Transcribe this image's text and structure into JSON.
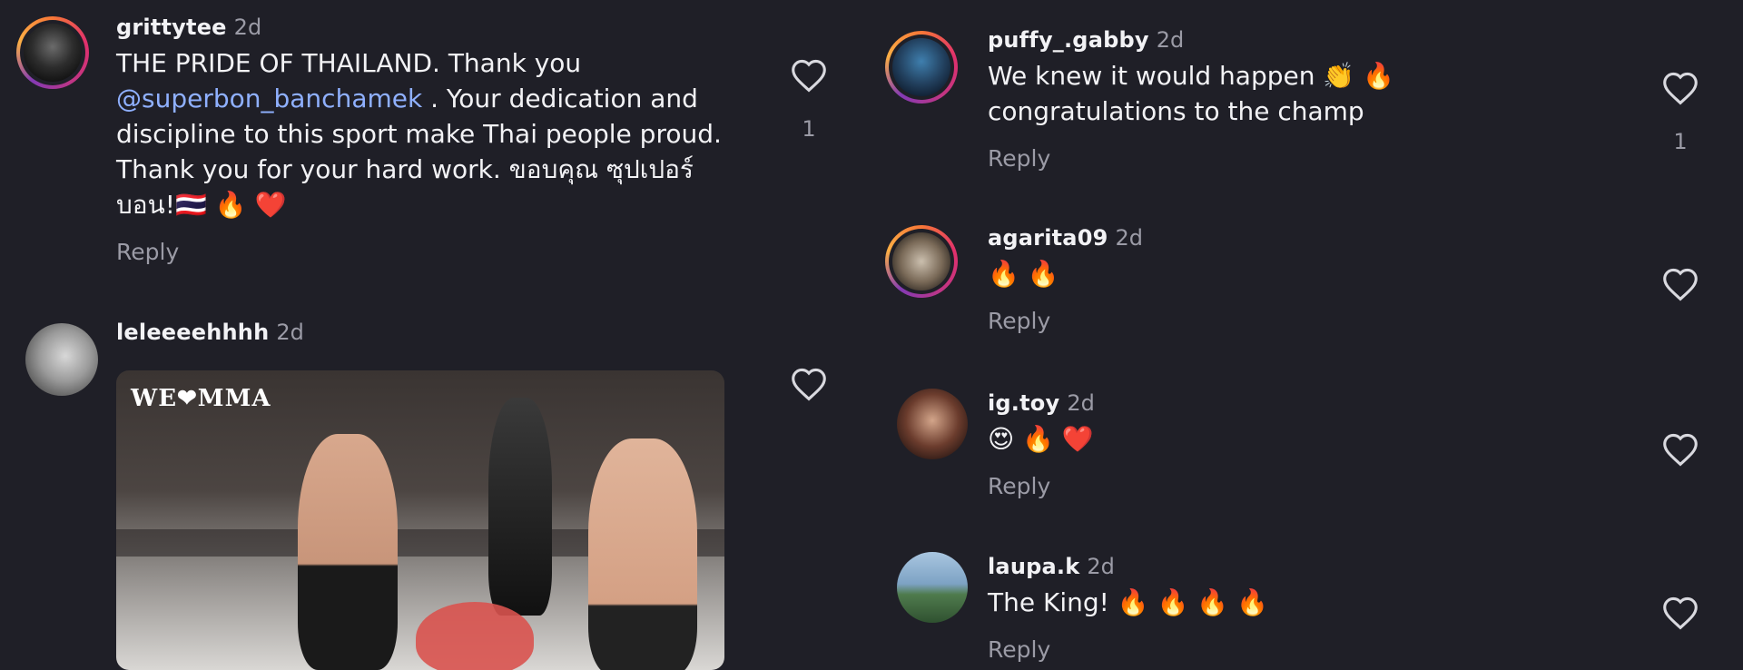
{
  "colors": {
    "background": "#1f1f27",
    "text": "#f2f2f5",
    "muted": "#9b9ba6",
    "mention": "#8fb0ff"
  },
  "left_comments": [
    {
      "username": "grittytee",
      "time": "2d",
      "text_pre": "THE PRIDE OF THAILAND. Thank you ",
      "mention": "@superbon_banchamek",
      "text_post": " . Your dedication and discipline to this sport make Thai people proud. Thank you for your hard work. ขอบคุณ ซุปเปอร์บอน!🇹🇭 🔥 ❤️",
      "reply_label": "Reply",
      "likes": "1",
      "icon": "heart-outline-icon"
    },
    {
      "username": "leleeeehhhh",
      "time": "2d",
      "media_logo": "WE❤MMA",
      "icon": "heart-outline-icon"
    }
  ],
  "right_comments": [
    {
      "username": "puffy_.gabby",
      "time": "2d",
      "text": "We knew it would happen 👏 🔥 congratulations to the champ",
      "reply_label": "Reply",
      "likes": "1"
    },
    {
      "username": "agarita09",
      "time": "2d",
      "text": "🔥 🔥",
      "reply_label": "Reply"
    },
    {
      "username": "ig.toy",
      "time": "2d",
      "text": "😍 🔥 ❤️",
      "reply_label": "Reply"
    },
    {
      "username": "laupa.k",
      "time": "2d",
      "text": "The King! 🔥 🔥 🔥 🔥",
      "reply_label": "Reply"
    }
  ]
}
